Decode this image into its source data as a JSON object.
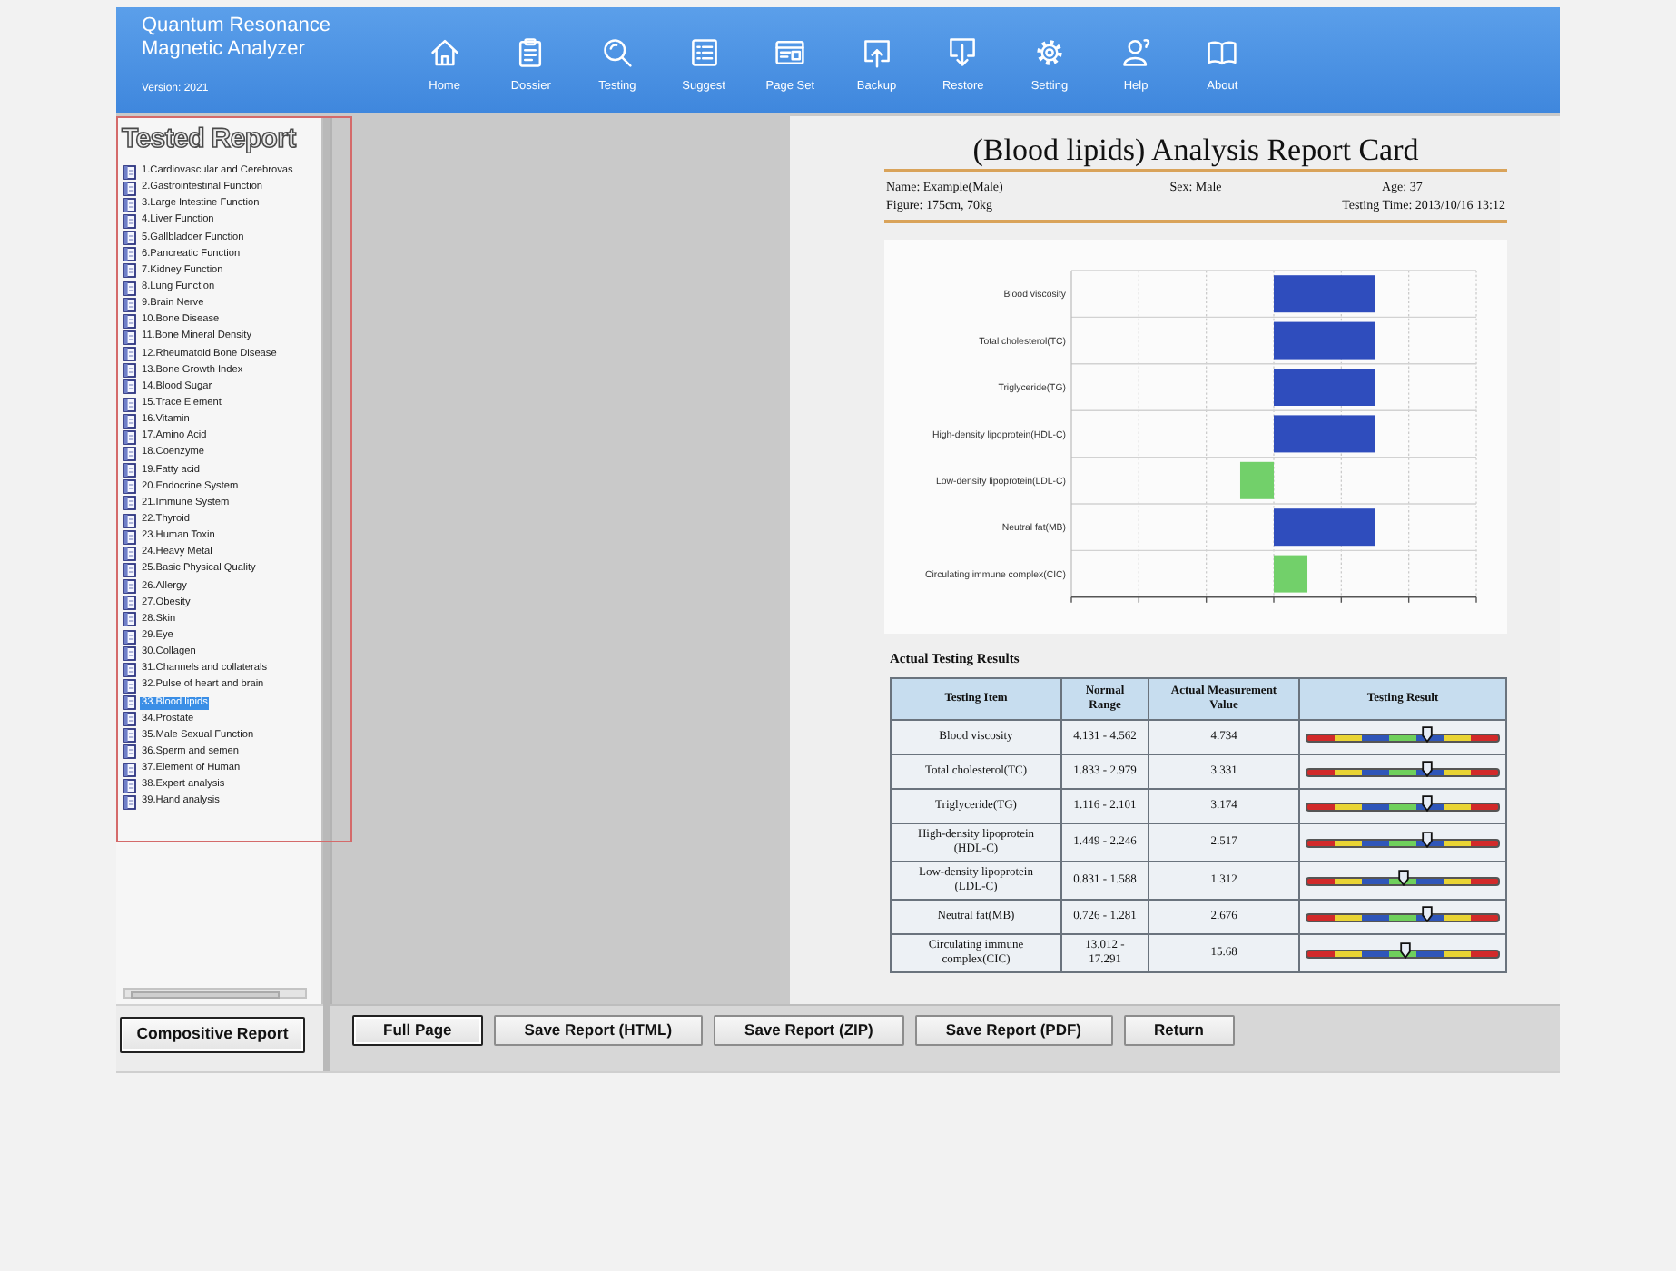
{
  "app": {
    "title": "Quantum Resonance Magnetic Analyzer",
    "version": "Version: 2021"
  },
  "toolbar": [
    {
      "label": "Home"
    },
    {
      "label": "Dossier"
    },
    {
      "label": "Testing"
    },
    {
      "label": "Suggest"
    },
    {
      "label": "Page Set"
    },
    {
      "label": "Backup"
    },
    {
      "label": "Restore"
    },
    {
      "label": "Setting"
    },
    {
      "label": "Help"
    },
    {
      "label": "About"
    }
  ],
  "sidebar": {
    "title": "Tested Report",
    "items": [
      {
        "label": "1.Cardiovascular and Cerebrovas",
        "selected": false
      },
      {
        "label": "2.Gastrointestinal Function",
        "selected": false
      },
      {
        "label": "3.Large Intestine Function",
        "selected": false
      },
      {
        "label": "4.Liver Function",
        "selected": false
      },
      {
        "label": "5.Gallbladder Function",
        "selected": false
      },
      {
        "label": "6.Pancreatic Function",
        "selected": false
      },
      {
        "label": "7.Kidney Function",
        "selected": false
      },
      {
        "label": "8.Lung Function",
        "selected": false
      },
      {
        "label": "9.Brain Nerve",
        "selected": false
      },
      {
        "label": "10.Bone Disease",
        "selected": false
      },
      {
        "label": "11.Bone Mineral Density",
        "selected": false
      },
      {
        "label": "12.Rheumatoid Bone Disease",
        "selected": false
      },
      {
        "label": "13.Bone Growth Index",
        "selected": false
      },
      {
        "label": "14.Blood Sugar",
        "selected": false
      },
      {
        "label": "15.Trace Element",
        "selected": false
      },
      {
        "label": "16.Vitamin",
        "selected": false
      },
      {
        "label": "17.Amino Acid",
        "selected": false
      },
      {
        "label": "18.Coenzyme",
        "selected": false
      },
      {
        "label": "19.Fatty acid",
        "selected": false
      },
      {
        "label": "20.Endocrine System",
        "selected": false
      },
      {
        "label": "21.Immune System",
        "selected": false
      },
      {
        "label": "22.Thyroid",
        "selected": false
      },
      {
        "label": "23.Human Toxin",
        "selected": false
      },
      {
        "label": "24.Heavy Metal",
        "selected": false
      },
      {
        "label": "25.Basic Physical Quality",
        "selected": false
      },
      {
        "label": "26.Allergy",
        "selected": false
      },
      {
        "label": "27.Obesity",
        "selected": false
      },
      {
        "label": "28.Skin",
        "selected": false
      },
      {
        "label": "29.Eye",
        "selected": false
      },
      {
        "label": "30.Collagen",
        "selected": false
      },
      {
        "label": "31.Channels and collaterals",
        "selected": false
      },
      {
        "label": "32.Pulse of heart and brain",
        "selected": false
      },
      {
        "label": "33.Blood lipids",
        "selected": true
      },
      {
        "label": "34.Prostate",
        "selected": false
      },
      {
        "label": "35.Male Sexual Function",
        "selected": false
      },
      {
        "label": "36.Sperm and semen",
        "selected": false
      },
      {
        "label": "37.Element of Human",
        "selected": false
      },
      {
        "label": "38.Expert analysis",
        "selected": false
      },
      {
        "label": "39.Hand analysis",
        "selected": false
      }
    ],
    "button": {
      "label": "Compositive Report",
      "focused": true
    }
  },
  "report": {
    "title": "(Blood lipids) Analysis Report Card",
    "info": [
      [
        "Name: Example(Male)",
        "Sex: Male",
        "Age: 37"
      ],
      [
        "Figure: 175cm, 70kg",
        "Testing Time: 2013/10/16 13:12"
      ]
    ]
  },
  "chart": {
    "bars": [
      {
        "label": "Blood viscosity",
        "color": "#2f4dbd"
      },
      {
        "label": "Total cholesterol(TC)",
        "color": "#2f4dbd"
      },
      {
        "label": "Triglyceride(TG)",
        "color": "#2f4dbd"
      },
      {
        "label": "High-density lipoprotein(HDL-C)",
        "color": "#2f4dbd"
      },
      {
        "label": "Low-density lipoprotein(LDL-C)",
        "color": "#72d06a"
      },
      {
        "label": "Neutral fat(MB)",
        "color": "#2f4dbd"
      },
      {
        "label": "Circulating immune complex(CIC)",
        "color": "#72d06a"
      }
    ]
  },
  "results": {
    "title": "Actual Testing Results",
    "columns": [
      "Testing Item",
      "Normal Range",
      "Actual Measurement Value",
      "Testing Result"
    ],
    "rows": [
      {
        "item": "Blood viscosity",
        "range": "4.131 - 4.562",
        "value": "4.734",
        "level": 0.63
      },
      {
        "item": "Total cholesterol(TC)",
        "range": "1.833 - 2.979",
        "value": "3.331",
        "level": 0.63
      },
      {
        "item": "Triglyceride(TG)",
        "range": "1.116 - 2.101",
        "value": "3.174",
        "level": 0.63
      },
      {
        "item": "High-density lipoprotein (HDL-C)",
        "range": "1.449 - 2.246",
        "value": "2.517",
        "level": 0.63
      },
      {
        "item": "Low-density lipoprotein (LDL-C)",
        "range": "0.831 - 1.588",
        "value": "1.312",
        "level": 0.5
      },
      {
        "item": "Neutral fat(MB)",
        "range": "0.726 - 1.281",
        "value": "2.676",
        "level": 0.63
      },
      {
        "item": "Circulating immune complex(CIC)",
        "range": "13.012 - 17.291",
        "value": "15.68",
        "level": 0.51
      }
    ]
  },
  "actions": [
    {
      "label": "Full Page",
      "focused": true
    },
    {
      "label": "Save Report (HTML)",
      "focused": false
    },
    {
      "label": "Save Report (ZIP)",
      "focused": false
    },
    {
      "label": "Save Report (PDF)",
      "focused": false
    },
    {
      "label": "Return",
      "focused": false
    }
  ]
}
